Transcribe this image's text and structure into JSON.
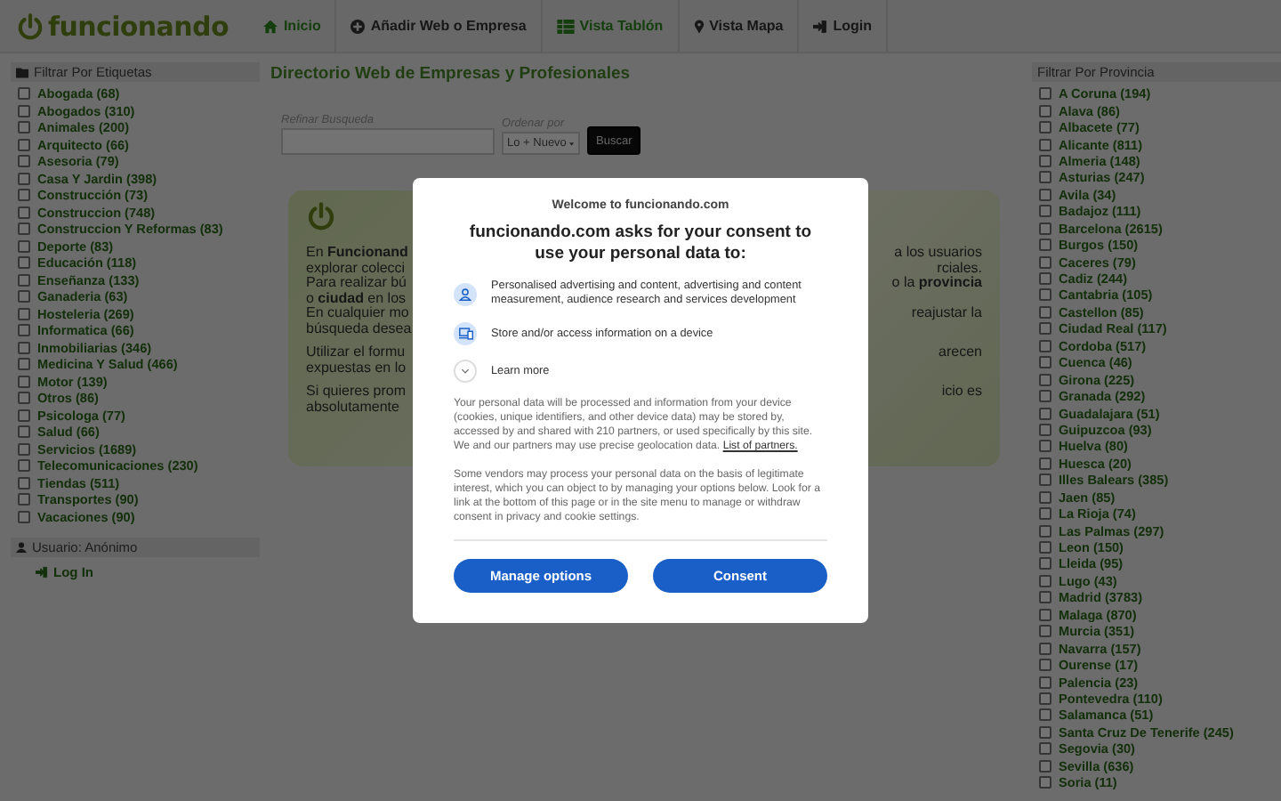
{
  "header": {
    "logo": "funcionando",
    "nav": [
      {
        "label": "Inicio",
        "highlighted": true
      },
      {
        "label": "Añadir Web o Empresa",
        "highlighted": false
      },
      {
        "label": "Vista Tablón",
        "highlighted": true
      },
      {
        "label": "Vista Mapa",
        "highlighted": false
      },
      {
        "label": "Login",
        "highlighted": false
      }
    ]
  },
  "tags": {
    "title": "Filtrar Por Etiquetas",
    "items": [
      {
        "label": "Abogada (68)",
        "checked": false
      },
      {
        "label": "Abogados (310)",
        "checked": false
      },
      {
        "label": "Animales (200)",
        "checked": false
      },
      {
        "label": "Arquitecto (66)",
        "checked": false
      },
      {
        "label": "Asesoria (79)",
        "checked": false
      },
      {
        "label": "Casa Y Jardin (398)",
        "checked": false
      },
      {
        "label": "Construcción (73)",
        "checked": false
      },
      {
        "label": "Construccion (748)",
        "checked": false
      },
      {
        "label": "Construccion Y Reformas (83)",
        "checked": false
      },
      {
        "label": "Deporte (83)",
        "checked": false
      },
      {
        "label": "Educación (118)",
        "checked": false
      },
      {
        "label": "Enseñanza (133)",
        "checked": false
      },
      {
        "label": "Ganaderia (63)",
        "checked": false
      },
      {
        "label": "Hosteleria (269)",
        "checked": false
      },
      {
        "label": "Informatica (66)",
        "checked": false
      },
      {
        "label": "Inmobiliarias (346)",
        "checked": false
      },
      {
        "label": "Medicina Y Salud (466)",
        "checked": false
      },
      {
        "label": "Motor (139)",
        "checked": false
      },
      {
        "label": "Otros (86)",
        "checked": false
      },
      {
        "label": "Psicologa (77)",
        "checked": false
      },
      {
        "label": "Salud (66)",
        "checked": false
      },
      {
        "label": "Servicios (1689)",
        "checked": false
      },
      {
        "label": "Telecomunicaciones (230)",
        "checked": false
      },
      {
        "label": "Tiendas (511)",
        "checked": false
      },
      {
        "label": "Transportes (90)",
        "checked": false
      },
      {
        "label": "Vacaciones (90)",
        "checked": false
      }
    ]
  },
  "user": {
    "title": "Usuario: Anónimo",
    "link": "Log In"
  },
  "main": {
    "title": "Directorio Web de Empresas y Profesionales",
    "search": {
      "label": "Refinar Busqueda"
    },
    "order": {
      "label": "Ordenar por",
      "value": "Lo + Nuevo"
    },
    "button": "Buscar",
    "intro": [
      [
        {
          "left": "En **Funcionand**",
          "right": "a los usuarios"
        },
        {
          "left": "explorar colecci",
          "right": "rciales."
        },
        {
          "left": "Para realizar bú",
          "right": "o la **provincia**"
        },
        {
          "left": "o **ciudad** en los"
        },
        {
          "left": "En cualquier mo",
          "right": "reajustar la"
        },
        {
          "left": "búsqueda desea"
        }
      ],
      [
        {
          "left": "Utilizar el formu",
          "right": "arecen"
        },
        {
          "left": "expuestas en lo"
        }
      ],
      [
        {
          "left": "Si quieres prom",
          "right": "icio es"
        },
        {
          "left": "absolutamente"
        }
      ]
    ]
  },
  "provinces": {
    "title": "Filtrar Por Provincia",
    "items": [
      {
        "label": "A Coruna (194)",
        "checked": false
      },
      {
        "label": "Alava (86)",
        "checked": false
      },
      {
        "label": "Albacete (77)",
        "checked": false
      },
      {
        "label": "Alicante (811)",
        "checked": false
      },
      {
        "label": "Almeria (148)",
        "checked": false
      },
      {
        "label": "Asturias (247)",
        "checked": false
      },
      {
        "label": "Avila (34)",
        "checked": false
      },
      {
        "label": "Badajoz (111)",
        "checked": false
      },
      {
        "label": "Barcelona (2615)",
        "checked": false
      },
      {
        "label": "Burgos (150)",
        "checked": false
      },
      {
        "label": "Caceres (79)",
        "checked": false
      },
      {
        "label": "Cadiz (244)",
        "checked": false
      },
      {
        "label": "Cantabria (105)",
        "checked": false
      },
      {
        "label": "Castellon (85)",
        "checked": false
      },
      {
        "label": "Ciudad Real (117)",
        "checked": false
      },
      {
        "label": "Cordoba (517)",
        "checked": false
      },
      {
        "label": "Cuenca (46)",
        "checked": false
      },
      {
        "label": "Girona (225)",
        "checked": false
      },
      {
        "label": "Granada (292)",
        "checked": false
      },
      {
        "label": "Guadalajara (51)",
        "checked": false
      },
      {
        "label": "Guipuzcoa (93)",
        "checked": false
      },
      {
        "label": "Huelva (80)",
        "checked": false
      },
      {
        "label": "Huesca (20)",
        "checked": false
      },
      {
        "label": "Illes Balears (385)",
        "checked": false
      },
      {
        "label": "Jaen (85)",
        "checked": false
      },
      {
        "label": "La Rioja (74)",
        "checked": false
      },
      {
        "label": "Las Palmas (297)",
        "checked": false
      },
      {
        "label": "Leon (150)",
        "checked": false
      },
      {
        "label": "Lleida (95)",
        "checked": false
      },
      {
        "label": "Lugo (43)",
        "checked": false
      },
      {
        "label": "Madrid (3783)",
        "checked": false
      },
      {
        "label": "Malaga (870)",
        "checked": false
      },
      {
        "label": "Murcia (351)",
        "checked": false
      },
      {
        "label": "Navarra (157)",
        "checked": false
      },
      {
        "label": "Ourense (17)",
        "checked": false
      },
      {
        "label": "Palencia (23)",
        "checked": false
      },
      {
        "label": "Pontevedra (110)",
        "checked": false
      },
      {
        "label": "Salamanca (51)",
        "checked": false
      },
      {
        "label": "Santa Cruz De Tenerife (245)",
        "checked": false
      },
      {
        "label": "Segovia (30)",
        "checked": false
      },
      {
        "label": "Sevilla (636)",
        "checked": false
      },
      {
        "label": "Soria (11)",
        "checked": false
      }
    ]
  },
  "consent": {
    "welcome": "Welcome to funcionando.com",
    "heading": "funcionando.com asks for your consent to use your personal data to:",
    "purposes": [
      {
        "text": "Personalised advertising and content, advertising and content measurement, audience research and services development"
      },
      {
        "text": "Store and/or access information on a device"
      }
    ],
    "learn_more": {
      "label": "Learn more",
      "expanded": false
    },
    "paragraph_1": "Your personal data will be processed and information from your device (cookies, unique identifiers, and other device data) may be stored by, accessed by and shared with 210 partners, or used specifically by this site. We and our partners may use precise geolocation data.",
    "partners_link": "List of partners.",
    "paragraph_2": "Some vendors may process your personal data on the basis of legitimate interest, which you can object to by managing your options below. Look for a link at the bottom of this page or in the site menu to manage or withdraw consent in privacy and cookie settings.",
    "buttons": [
      "Manage options",
      "Consent"
    ]
  }
}
